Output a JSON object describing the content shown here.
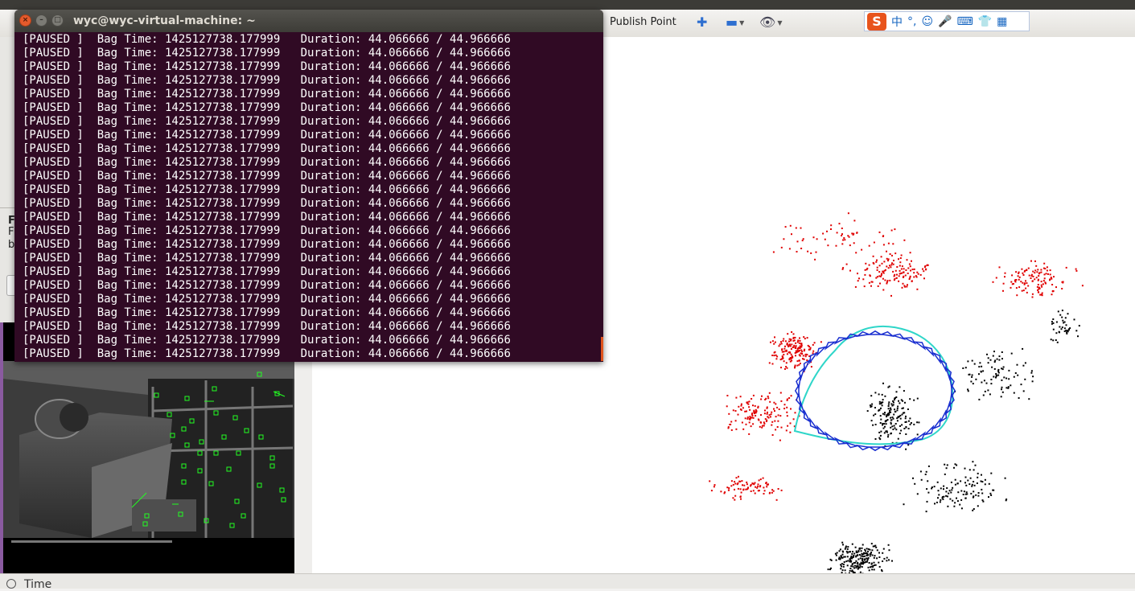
{
  "terminal": {
    "title": "wyc@wyc-virtual-machine: ~",
    "close_glyph": "×",
    "min_glyph": "–",
    "max_glyph": "□",
    "lines": [
      "[PAUSED ]  Bag Time: 1425127738.177999   Duration: 44.066666 / 44.966666",
      "[PAUSED ]  Bag Time: 1425127738.177999   Duration: 44.066666 / 44.966666",
      "[PAUSED ]  Bag Time: 1425127738.177999   Duration: 44.066666 / 44.966666",
      "[PAUSED ]  Bag Time: 1425127738.177999   Duration: 44.066666 / 44.966666",
      "[PAUSED ]  Bag Time: 1425127738.177999   Duration: 44.066666 / 44.966666",
      "[PAUSED ]  Bag Time: 1425127738.177999   Duration: 44.066666 / 44.966666",
      "[PAUSED ]  Bag Time: 1425127738.177999   Duration: 44.066666 / 44.966666",
      "[PAUSED ]  Bag Time: 1425127738.177999   Duration: 44.066666 / 44.966666",
      "[PAUSED ]  Bag Time: 1425127738.177999   Duration: 44.066666 / 44.966666",
      "[PAUSED ]  Bag Time: 1425127738.177999   Duration: 44.066666 / 44.966666",
      "[PAUSED ]  Bag Time: 1425127738.177999   Duration: 44.066666 / 44.966666",
      "[PAUSED ]  Bag Time: 1425127738.177999   Duration: 44.066666 / 44.966666",
      "[PAUSED ]  Bag Time: 1425127738.177999   Duration: 44.066666 / 44.966666",
      "[PAUSED ]  Bag Time: 1425127738.177999   Duration: 44.066666 / 44.966666",
      "[PAUSED ]  Bag Time: 1425127738.177999   Duration: 44.066666 / 44.966666",
      "[PAUSED ]  Bag Time: 1425127738.177999   Duration: 44.066666 / 44.966666",
      "[PAUSED ]  Bag Time: 1425127738.177999   Duration: 44.066666 / 44.966666",
      "[PAUSED ]  Bag Time: 1425127738.177999   Duration: 44.066666 / 44.966666",
      "[PAUSED ]  Bag Time: 1425127738.177999   Duration: 44.066666 / 44.966666",
      "[PAUSED ]  Bag Time: 1425127738.177999   Duration: 44.066666 / 44.966666",
      "[PAUSED ]  Bag Time: 1425127738.177999   Duration: 44.066666 / 44.966666",
      "[PAUSED ]  Bag Time: 1425127738.177999   Duration: 44.066666 / 44.966666",
      "[PAUSED ]  Bag Time: 1425127738.177999   Duration: 44.066666 / 44.966666",
      "[PAUSED ]  Bag Time: 1425127738.177999   Duration: 44.066666 / 44.966666"
    ]
  },
  "rviz_toolbar": {
    "publish_point_label": "Publish Point",
    "add_icon": "plus-icon",
    "remove_icon": "minus-icon",
    "view_icon": "eye-icon"
  },
  "ime_bar": {
    "logo": "S",
    "mode": "中",
    "punct": "°,",
    "icons": [
      "smiley-icon",
      "microphone-icon",
      "keyboard-icon",
      "shirt-icon",
      "grid-icon"
    ]
  },
  "left_panel": {
    "letter_f1": "F",
    "letter_f2": "F",
    "letter_b": "b"
  },
  "time_panel": {
    "label": "Time"
  },
  "colors": {
    "terminal_bg": "#300a24",
    "map_points_red": "#e00000",
    "map_points_black": "#000000",
    "camera_pose": "#1a2fd0",
    "trajectory": "#2fd6c9",
    "features": "#22ff22"
  }
}
